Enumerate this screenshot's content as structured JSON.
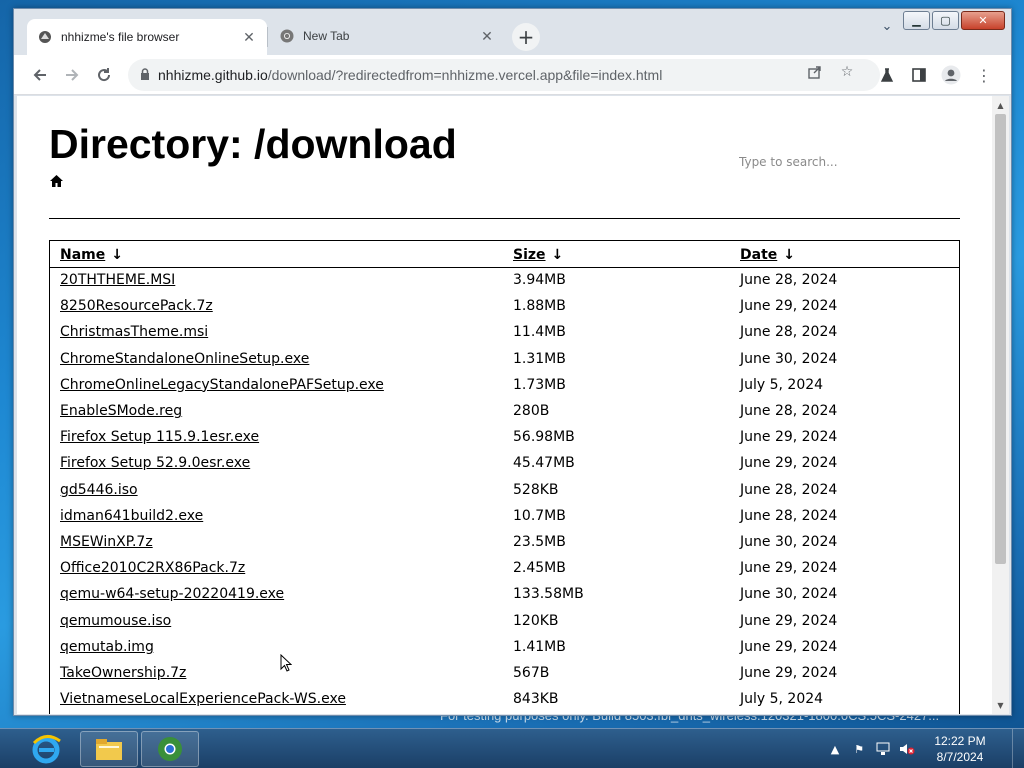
{
  "desktop": {
    "watermark": "For testing purposes only. Build 8503.fbl_dnts_wireless.120321-1800.0CS.5CS-2427..."
  },
  "browser": {
    "tabs": [
      {
        "title": "nhhizme's file browser",
        "icon": "favicon-icon",
        "active": true
      },
      {
        "title": "New Tab",
        "icon": "chrome-icon",
        "active": false
      }
    ],
    "new_tab_label": "+",
    "url_host": "nhhizme.github.io",
    "url_rest": "/download/?redirectedfrom=nhhizme.vercel.app&file=index.html",
    "icons": {
      "back": "arrow-left-icon",
      "forward": "arrow-right-icon",
      "reload": "reload-icon",
      "lock": "lock-icon",
      "share": "share-icon",
      "bookmark": "star-icon",
      "extensions": "flask-icon",
      "sidepanel": "sidepanel-icon",
      "profile": "profile-icon",
      "menu": "kebab-menu-icon"
    }
  },
  "page": {
    "title": "Directory: /download",
    "search_placeholder": "Type to search...",
    "table": {
      "headers": {
        "name": "Name",
        "size": "Size",
        "date": "Date",
        "arrow": "↓"
      },
      "rows": [
        {
          "name": "20THTHEME.MSI",
          "size": "3.94MB",
          "date": "June 28, 2024"
        },
        {
          "name": "8250ResourcePack.7z",
          "size": "1.88MB",
          "date": "June 29, 2024"
        },
        {
          "name": "ChristmasTheme.msi",
          "size": "11.4MB",
          "date": "June 28, 2024"
        },
        {
          "name": "ChromeStandaloneOnlineSetup.exe",
          "size": "1.31MB",
          "date": "June 30, 2024"
        },
        {
          "name": "ChromeOnlineLegacyStandalonePAFSetup.exe",
          "size": "1.73MB",
          "date": "July 5, 2024"
        },
        {
          "name": "EnableSMode.reg",
          "size": "280B",
          "date": "June 28, 2024"
        },
        {
          "name": "Firefox Setup 115.9.1esr.exe",
          "size": "56.98MB",
          "date": "June 29, 2024"
        },
        {
          "name": "Firefox Setup 52.9.0esr.exe",
          "size": "45.47MB",
          "date": "June 29, 2024"
        },
        {
          "name": "gd5446.iso",
          "size": "528KB",
          "date": "June 28, 2024"
        },
        {
          "name": "idman641build2.exe",
          "size": "10.7MB",
          "date": "June 28, 2024"
        },
        {
          "name": "MSEWinXP.7z",
          "size": "23.5MB",
          "date": "June 30, 2024"
        },
        {
          "name": "Office2010C2RX86Pack.7z",
          "size": "2.45MB",
          "date": "June 29, 2024"
        },
        {
          "name": "qemu-w64-setup-20220419.exe",
          "size": "133.58MB",
          "date": "June 30, 2024"
        },
        {
          "name": "qemumouse.iso",
          "size": "120KB",
          "date": "June 29, 2024"
        },
        {
          "name": "qemutab.img",
          "size": "1.41MB",
          "date": "June 29, 2024"
        },
        {
          "name": "TakeOwnership.7z",
          "size": "567B",
          "date": "June 29, 2024"
        },
        {
          "name": "VietnameseLocalExperiencePack-WS.exe",
          "size": "843KB",
          "date": "July 5, 2024"
        }
      ]
    }
  },
  "taskbar": {
    "clock_time": "12:22 PM",
    "clock_date": "8/7/2024",
    "tray_icons": [
      "show-hidden-icons-icon",
      "action-center-flag-icon",
      "network-icon",
      "volume-muted-icon"
    ]
  }
}
